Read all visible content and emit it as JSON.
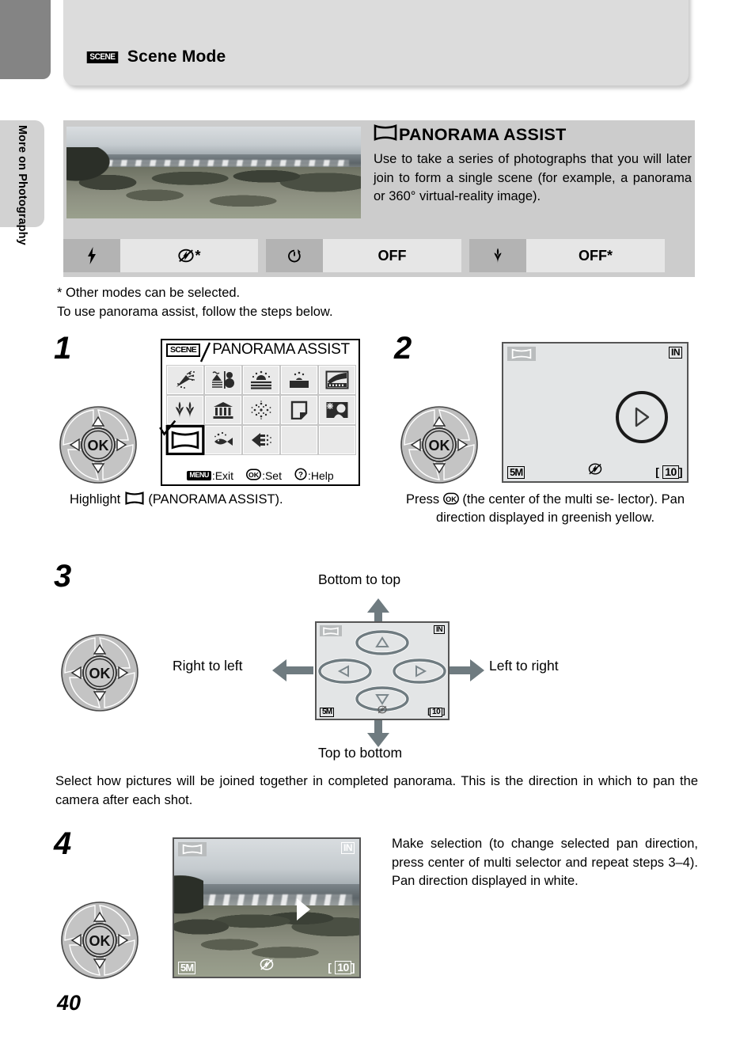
{
  "sidebar": {
    "tab_label": "More on Photography"
  },
  "header": {
    "scene_chip": "SCENE",
    "title": "Scene Mode"
  },
  "description": {
    "title": "PANORAMA ASSIST",
    "title_icon": "panorama-glyph",
    "body": "Use to take a series of photographs that you will later join to form a single scene (for example, a panorama or 360° virtual-reality image).",
    "photo_alt": "coastal-panorama-photo"
  },
  "settings": [
    {
      "icon": "flash-icon",
      "value_icon": "flash-off-icon",
      "value": "*"
    },
    {
      "icon": "self-timer-icon",
      "value": "OFF"
    },
    {
      "icon": "macro-icon",
      "value": "OFF*"
    }
  ],
  "footnote": {
    "line1": "* Other modes can be selected.",
    "line2": "To use panorama assist, follow the steps below."
  },
  "steps": {
    "one": {
      "number": "1",
      "caption_pre": "Highlight",
      "caption_post": "(PANORAMA ASSIST)."
    },
    "two": {
      "number": "2",
      "caption": "Press ⒪ (the center of the multi se-lector). Pan direction displayed in greenish yellow.",
      "caption_line1_pre": "Press",
      "caption_line1_post": "(the center of the multi se-",
      "caption_line2": "lector). Pan direction displayed in",
      "caption_line3": "greenish yellow."
    },
    "three": {
      "number": "3",
      "label_top": "Bottom to top",
      "label_left": "Right to left",
      "label_right": "Left to right",
      "label_bottom": "Top to bottom",
      "body": "Select how pictures will be joined together in completed panorama. This is the direction in which to pan the camera after each shot."
    },
    "four": {
      "number": "4",
      "body": "Make selection (to change selected pan direction, press center of multi selector and repeat steps 3–4). Pan direction displayed in white."
    }
  },
  "scene_menu": {
    "tag": "SCENE",
    "title": "PANORAMA ASSIST",
    "icons": [
      "party-indoor-icon",
      "beach-snow-icon",
      "sunset-icon",
      "dusk-dawn-icon",
      "night-landscape-icon",
      "close-up-icon",
      "museum-icon",
      "fireworks-show-icon",
      "copy-icon",
      "back-light-icon",
      "panorama-assist-icon",
      "underwater-icon",
      "sports-icon",
      "",
      ""
    ],
    "selected_index": 10,
    "footer": [
      {
        "key": "MENU",
        "label": ":Exit"
      },
      {
        "key": "OK",
        "label": ":Set"
      },
      {
        "key": "?",
        "label": ":Help"
      }
    ]
  },
  "camera_display": {
    "pano_badge": "panorama-icon",
    "memory": "IN",
    "image_size": "5M",
    "flash_mode": "flash-off-icon",
    "shots_remaining": "10",
    "shots_bracket_left": "[",
    "shots_bracket_right": "]"
  },
  "multi_selector": {
    "center_label": "OK",
    "arrows": [
      "up-arrow-icon",
      "right-arrow-icon",
      "down-arrow-icon",
      "left-arrow-icon"
    ]
  },
  "page_number": "40"
}
